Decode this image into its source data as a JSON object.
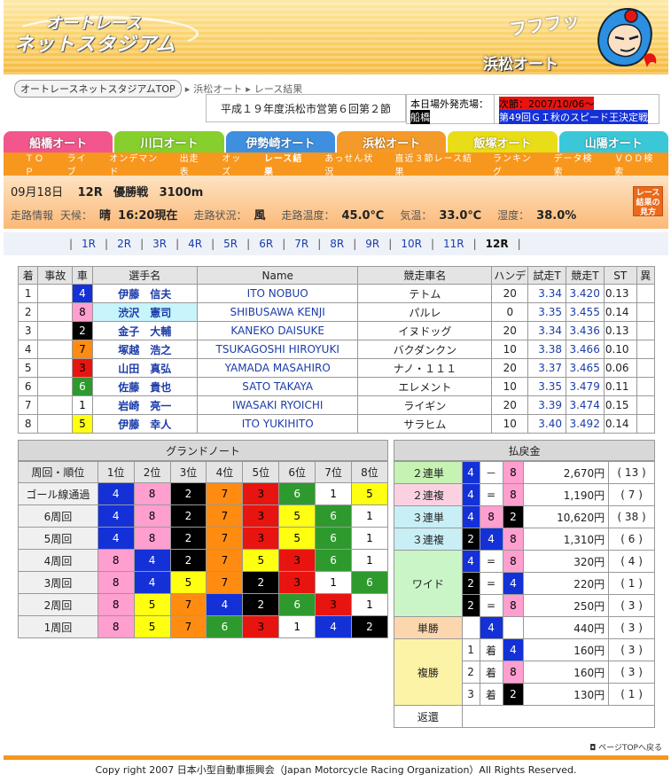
{
  "header": {
    "logo_line1": "オートレース",
    "logo_line2": "ネットスタジアム",
    "venue_title": "浜松オート",
    "mascot_text": "フフフッ"
  },
  "breadcrumb": {
    "home": "オートレースネットスタジアムTOP",
    "venue": "浜松オート",
    "current": "レース結果"
  },
  "race_event": "平成１９年度浜松市営第６回第２節",
  "offsite": {
    "label": "本日場外発売場：",
    "venue": "船橋",
    "next_label": "次節：2007/10/06～",
    "next_event": "第49回ＧＩ秋のスピード王決定戦"
  },
  "venue_tabs": [
    {
      "label": "船橋オート",
      "color": "#f2568c"
    },
    {
      "label": "川口オート",
      "color": "#86cf2c"
    },
    {
      "label": "伊勢崎オート",
      "color": "#3f8fe0"
    },
    {
      "label": "浜松オート",
      "color": "#f39a2a"
    },
    {
      "label": "飯塚オート",
      "color": "#e9dd18"
    },
    {
      "label": "山陽オート",
      "color": "#3ac8d8"
    }
  ],
  "subnav": [
    "ＴＯＰ",
    "ライブ",
    "オンデマンド",
    "出走表",
    "オッズ",
    "レース結果",
    "あっせん状況",
    "直近３節レース結果",
    "ランキング",
    "データ検索",
    "ＶＯＤ検索"
  ],
  "race_info": {
    "date": "09月18日",
    "race_no": "12R",
    "race_name": "優勝戦",
    "distance": "3100m",
    "track_label": "走路情報",
    "weather_label": "天候：",
    "weather": "晴",
    "time": "16:20現在",
    "track_state_label": "走路状況：",
    "track_state": "風",
    "track_temp_label": "走路温度：",
    "track_temp": "45.0℃",
    "air_temp_label": "気温：",
    "air_temp": "33.0℃",
    "humidity_label": "湿度：",
    "humidity": "38.0%",
    "guide_button": "レース結果の見方"
  },
  "race_nav": [
    "1R",
    "2R",
    "3R",
    "4R",
    "5R",
    "6R",
    "7R",
    "8R",
    "9R",
    "10R",
    "11R",
    "12R"
  ],
  "results": {
    "headers": [
      "着",
      "事故",
      "車",
      "選手名",
      "Name",
      "競走車名",
      "ハンデ",
      "試走T",
      "競走T",
      "ST",
      "異"
    ],
    "rows": [
      {
        "pos": "1",
        "acc": "",
        "car": "4",
        "name": "伊藤　信夫",
        "en": "ITO NOBUO",
        "bike": "テトム",
        "hande": "20",
        "trial": "3.34",
        "race": "3.420",
        "st": "0.13",
        "ab": ""
      },
      {
        "pos": "2",
        "acc": "",
        "car": "8",
        "name": "渋沢　憲司",
        "en": "SHIBUSAWA KENJI",
        "bike": "パルレ",
        "hande": "0",
        "trial": "3.35",
        "race": "3.455",
        "st": "0.14",
        "ab": ""
      },
      {
        "pos": "3",
        "acc": "",
        "car": "2",
        "name": "金子　大輔",
        "en": "KANEKO DAISUKE",
        "bike": "イヌドッグ",
        "hande": "20",
        "trial": "3.34",
        "race": "3.436",
        "st": "0.13",
        "ab": ""
      },
      {
        "pos": "4",
        "acc": "",
        "car": "7",
        "name": "塚越　浩之",
        "en": "TSUKAGOSHI HIROYUKI",
        "bike": "バクダンクン",
        "hande": "10",
        "trial": "3.38",
        "race": "3.466",
        "st": "0.10",
        "ab": ""
      },
      {
        "pos": "5",
        "acc": "",
        "car": "3",
        "name": "山田　真弘",
        "en": "YAMADA MASAHIRO",
        "bike": "ナノ・１１１",
        "hande": "20",
        "trial": "3.37",
        "race": "3.465",
        "st": "0.06",
        "ab": ""
      },
      {
        "pos": "6",
        "acc": "",
        "car": "6",
        "name": "佐藤　貴也",
        "en": "SATO TAKAYA",
        "bike": "エレメント",
        "hande": "10",
        "trial": "3.35",
        "race": "3.479",
        "st": "0.11",
        "ab": ""
      },
      {
        "pos": "7",
        "acc": "",
        "car": "1",
        "name": "岩崎　亮一",
        "en": "IWASAKI RYOICHI",
        "bike": "ライギン",
        "hande": "20",
        "trial": "3.39",
        "race": "3.474",
        "st": "0.15",
        "ab": ""
      },
      {
        "pos": "8",
        "acc": "",
        "car": "5",
        "name": "伊藤　幸人",
        "en": "ITO YUKIHITO",
        "bike": "サラヒム",
        "hande": "10",
        "trial": "3.40",
        "race": "3.492",
        "st": "0.14",
        "ab": ""
      }
    ]
  },
  "grand_note": {
    "title": "グランドノート",
    "headers": [
      "周回・順位",
      "1位",
      "2位",
      "3位",
      "4位",
      "5位",
      "6位",
      "7位",
      "8位"
    ],
    "rows": [
      {
        "label": "ゴール線通過",
        "cars": [
          "4",
          "8",
          "2",
          "7",
          "3",
          "6",
          "1",
          "5"
        ]
      },
      {
        "label": "6周回",
        "cars": [
          "4",
          "8",
          "2",
          "7",
          "3",
          "5",
          "6",
          "1"
        ]
      },
      {
        "label": "5周回",
        "cars": [
          "4",
          "8",
          "2",
          "7",
          "3",
          "5",
          "6",
          "1"
        ]
      },
      {
        "label": "4周回",
        "cars": [
          "8",
          "4",
          "2",
          "7",
          "5",
          "3",
          "6",
          "1"
        ]
      },
      {
        "label": "3周回",
        "cars": [
          "8",
          "4",
          "5",
          "7",
          "2",
          "3",
          "1",
          "6"
        ]
      },
      {
        "label": "2周回",
        "cars": [
          "8",
          "5",
          "7",
          "4",
          "2",
          "6",
          "3",
          "1"
        ]
      },
      {
        "label": "1周回",
        "cars": [
          "8",
          "5",
          "7",
          "6",
          "3",
          "1",
          "4",
          "2"
        ]
      }
    ]
  },
  "payout": {
    "title": "払戻金",
    "nirentan": {
      "label": "２連単",
      "a": "4",
      "sep": "－",
      "b": "8",
      "amount": "2,670円",
      "pop": "( 13 )"
    },
    "nirenpuku": {
      "label": "２連複",
      "a": "4",
      "sep": "=",
      "b": "8",
      "amount": "1,190円",
      "pop": "( 7 )"
    },
    "sanrentan": {
      "label": "３連単",
      "a": "4",
      "b": "8",
      "c": "2",
      "amount": "10,620円",
      "pop": "( 38 )"
    },
    "sanrenpuku": {
      "label": "３連複",
      "a": "2",
      "b": "4",
      "c": "8",
      "amount": "1,310円",
      "pop": "( 6 )"
    },
    "wide_label": "ワイド",
    "wide": [
      {
        "a": "4",
        "sep": "=",
        "b": "8",
        "amount": "320円",
        "pop": "( 4 )"
      },
      {
        "a": "2",
        "sep": "=",
        "b": "4",
        "amount": "220円",
        "pop": "( 1 )"
      },
      {
        "a": "2",
        "sep": "=",
        "b": "8",
        "amount": "250円",
        "pop": "( 3 )"
      }
    ],
    "tansho": {
      "label": "単勝",
      "a": "4",
      "amount": "440円",
      "pop": "( 3 )"
    },
    "fukusho_label": "複勝",
    "chaku": "着",
    "fukusho": [
      {
        "pos": "1",
        "car": "4",
        "amount": "160円",
        "pop": "( 3 )"
      },
      {
        "pos": "2",
        "car": "8",
        "amount": "160円",
        "pop": "( 3 )"
      },
      {
        "pos": "3",
        "car": "2",
        "amount": "130円",
        "pop": "( 1 )"
      }
    ],
    "henkan_label": "返還",
    "henkan": ""
  },
  "pagetop": "ページTOPへ戻る",
  "footer": "Copy right 2007 日本小型自動車振興会（Japan Motorcycle Racing Organization）All Rights Reserved."
}
